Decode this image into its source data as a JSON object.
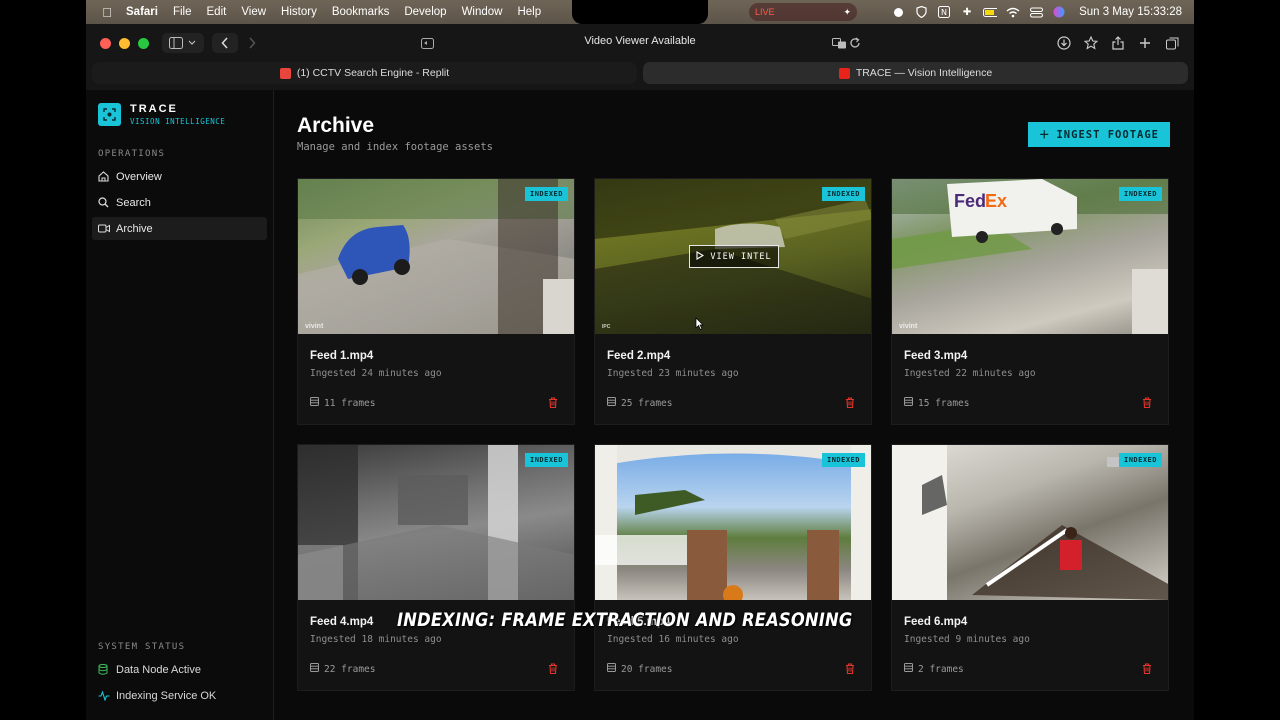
{
  "menubar": {
    "app": "Safari",
    "items": [
      "File",
      "Edit",
      "View",
      "History",
      "Bookmarks",
      "Develop",
      "Window",
      "Help"
    ],
    "live": "LIVE",
    "clock": "Sun 3 May  15:33:28"
  },
  "browser": {
    "url_text": "Video Viewer Available",
    "tabs": [
      {
        "label": "(1) CCTV Search Engine - Replit",
        "favicon_color": "#e8453c"
      },
      {
        "label": "TRACE — Vision Intelligence",
        "favicon_color": "#e8231a"
      }
    ]
  },
  "brand": {
    "name": "TRACE",
    "subtitle": "VISION INTELLIGENCE",
    "accent": "#19c4d8"
  },
  "sidebar": {
    "operations_label": "OPERATIONS",
    "items": [
      {
        "label": "Overview",
        "icon": "home-icon"
      },
      {
        "label": "Search",
        "icon": "search-icon"
      },
      {
        "label": "Archive",
        "icon": "video-icon",
        "active": true
      }
    ],
    "system_label": "SYSTEM STATUS",
    "status": [
      {
        "label": "Data Node Active",
        "icon": "database-icon",
        "color": "#3fbf5f"
      },
      {
        "label": "Indexing Service OK",
        "icon": "activity-icon",
        "color": "#19c4d8"
      }
    ]
  },
  "page": {
    "title": "Archive",
    "subtitle": "Manage and index footage assets",
    "ingest_button": "INGEST FOOTAGE"
  },
  "badge_label": "INDEXED",
  "view_intel_label": "VIEW INTEL",
  "feeds": [
    {
      "name": "Feed 1.mp4",
      "ingested": "Ingested 24 minutes ago",
      "frames": "11 frames",
      "watermark": "vivint"
    },
    {
      "name": "Feed 2.mp4",
      "ingested": "Ingested 23 minutes ago",
      "frames": "25 frames",
      "watermark": "IPC"
    },
    {
      "name": "Feed 3.mp4",
      "ingested": "Ingested 22 minutes ago",
      "frames": "15 frames",
      "watermark": "vivint"
    },
    {
      "name": "Feed 4.mp4",
      "ingested": "Ingested 18 minutes ago",
      "frames": "22 frames",
      "watermark": ""
    },
    {
      "name": "Feed 5.mp4",
      "ingested": "Ingested 16 minutes ago",
      "frames": "20 frames",
      "watermark": ""
    },
    {
      "name": "Feed 6.mp4",
      "ingested": "Ingested 9 minutes ago",
      "frames": "2 frames",
      "watermark": ""
    }
  ],
  "caption": "INDEXING: FRAME EXTRACTION AND REASONING"
}
